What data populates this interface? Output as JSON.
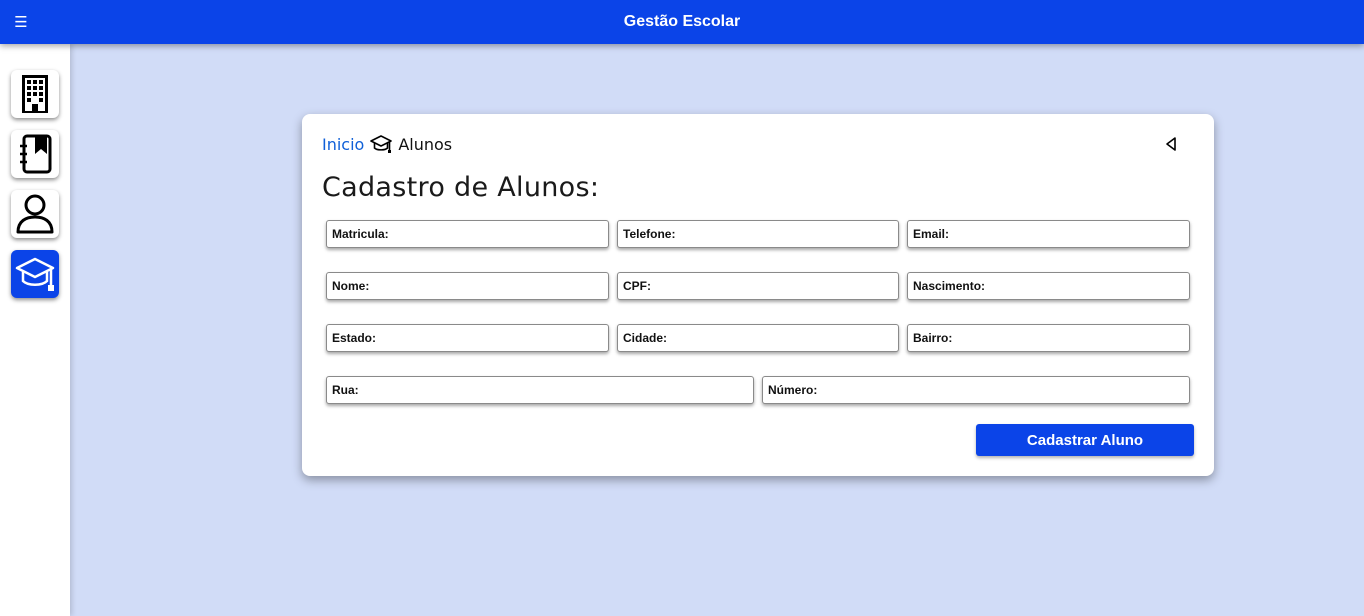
{
  "header": {
    "title": "Gestão Escolar",
    "menu_icon": "hamburger-menu-icon",
    "background": "#0b44e8"
  },
  "sidebar": {
    "items": [
      {
        "name": "school",
        "icon": "building-icon",
        "active": false
      },
      {
        "name": "subjects",
        "icon": "notebook-bookmark-icon",
        "active": false
      },
      {
        "name": "teachers",
        "icon": "user-icon",
        "active": false
      },
      {
        "name": "students",
        "icon": "graduation-cap-icon",
        "active": true
      }
    ]
  },
  "breadcrumb": {
    "home": "Inicio",
    "current": "Alunos",
    "icon": "graduation-cap-icon"
  },
  "back_icon": "caret-left-icon",
  "form": {
    "title": "Cadastro de Alunos:",
    "fields": {
      "matricula": "Matricula:",
      "telefone": "Telefone:",
      "email": "Email:",
      "nome": "Nome:",
      "cpf": "CPF:",
      "nascimento": "Nascimento:",
      "estado": "Estado:",
      "cidade": "Cidade:",
      "bairro": "Bairro:",
      "rua": "Rua:",
      "numero": "Número:"
    },
    "submit_label": "Cadastrar Aluno"
  },
  "colors": {
    "primary": "#0b44e8",
    "page_background": "#d1dcf7",
    "link": "#1060d8"
  }
}
